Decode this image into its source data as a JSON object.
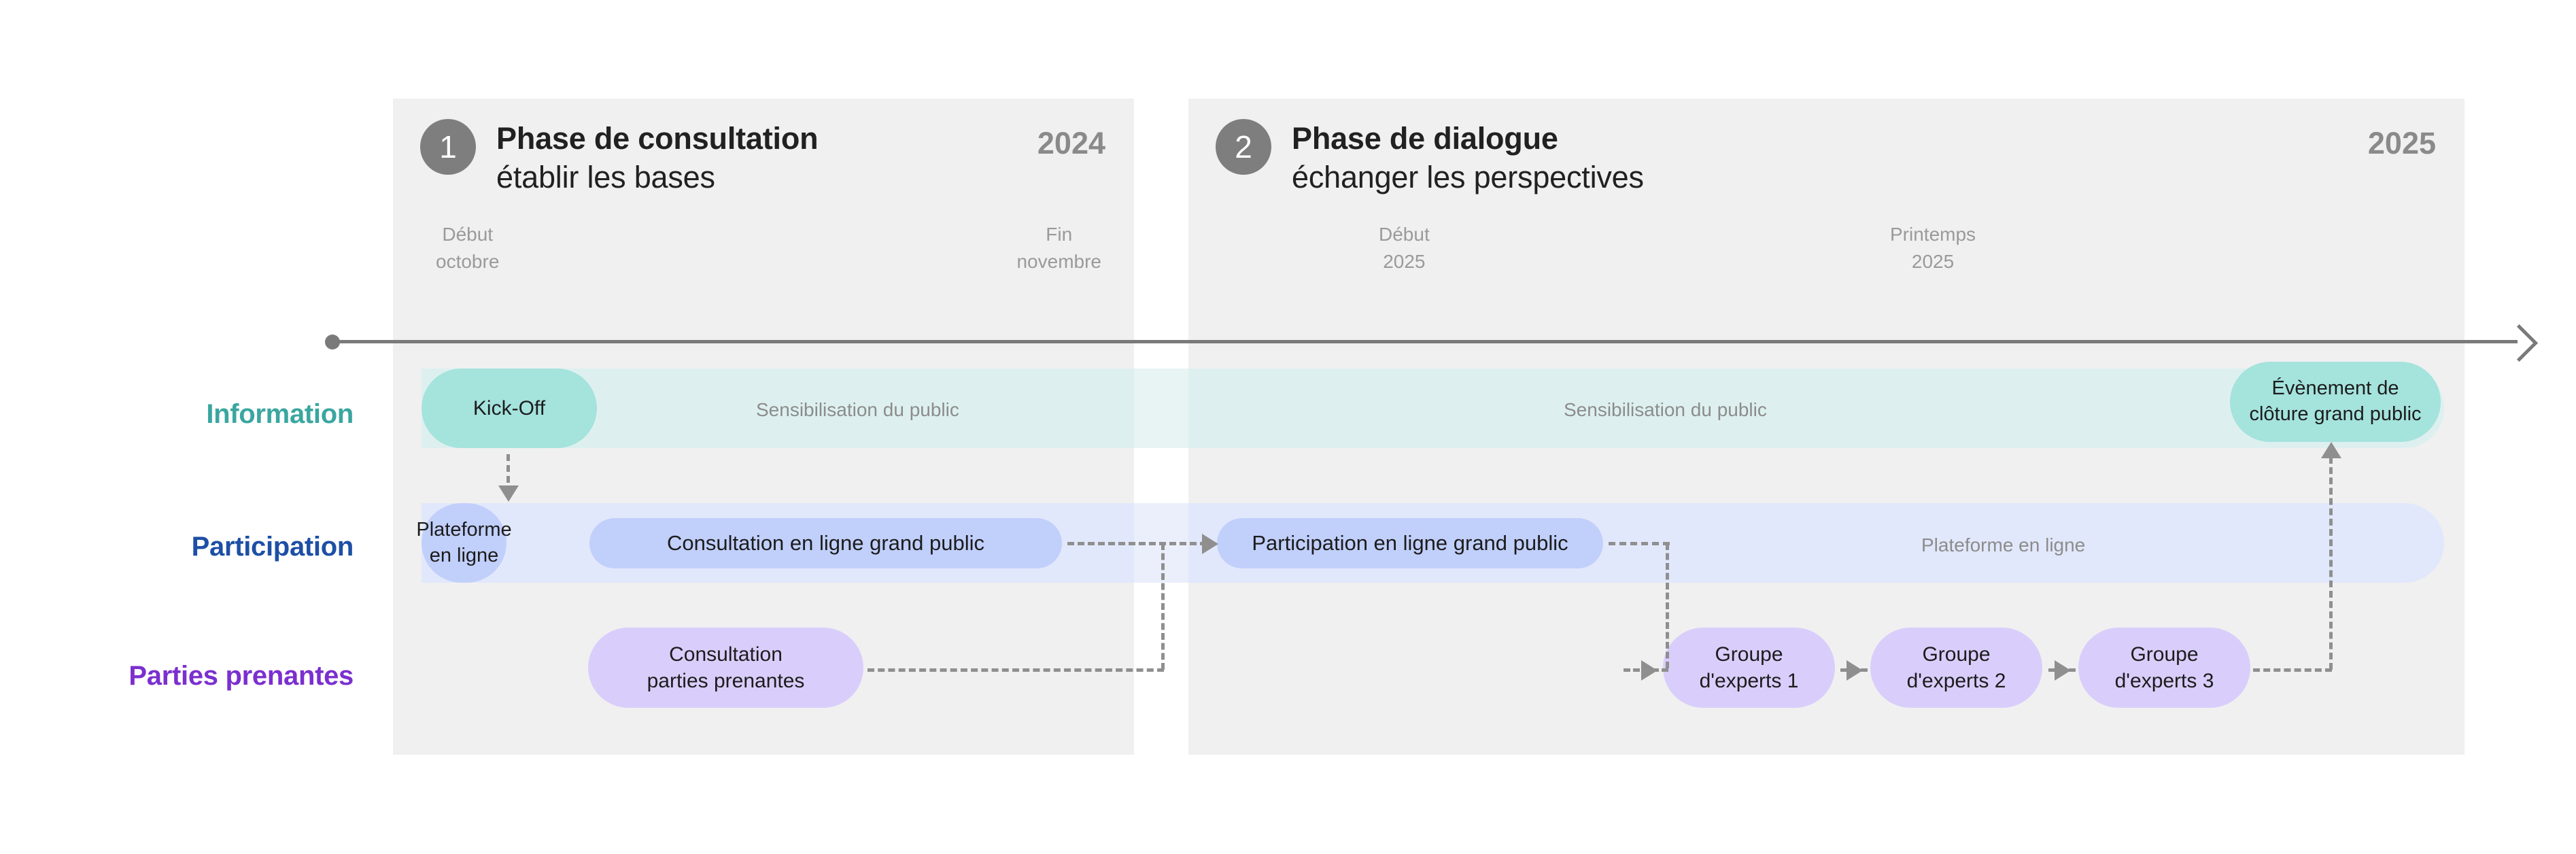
{
  "phases": [
    {
      "number": "1",
      "title": "Phase de consultation",
      "subtitle": "établir les bases",
      "year": "2024",
      "start_label": "Début\noctobre",
      "start_line1": "Début",
      "start_line2": "octobre",
      "end_line1": "Fin",
      "end_line2": "novembre"
    },
    {
      "number": "2",
      "title": "Phase de dialogue",
      "subtitle": "échanger les perspectives",
      "year": "2025",
      "start_line1": "Début",
      "start_line2": "2025",
      "end_line1": "Printemps",
      "end_line2": "2025"
    }
  ],
  "rows": [
    {
      "label": "Information",
      "color": "#3aa6a0"
    },
    {
      "label": "Participation",
      "color": "#1d4fa5"
    },
    {
      "label": "Parties prenantes",
      "color": "#7b2fcf"
    }
  ],
  "bands": {
    "information_caption_phase1": "Sensibilisation du public",
    "information_caption_phase2": "Sensibilisation du public",
    "participation_caption_phase2": "Plateforme en ligne"
  },
  "items": {
    "kickoff": "Kick-Off",
    "event_cloture_line1": "Évènement de",
    "event_cloture_line2": "clôture grand public",
    "plateforme_line1": "Plateforme",
    "plateforme_line2": "en ligne",
    "consultation_online": "Consultation en ligne grand public",
    "participation_online": "Participation en ligne grand public",
    "consultation_parties_line1": "Consultation",
    "consultation_parties_line2": "parties prenantes",
    "expert1_line1": "Groupe",
    "expert1_line2": "d'experts 1",
    "expert2_line1": "Groupe",
    "expert2_line2": "d'experts 2",
    "expert3_line1": "Groupe",
    "expert3_line2": "d'experts 3"
  },
  "colors": {
    "panel_bg": "#f0f0f0",
    "axis": "#7a7a7a",
    "badge": "#7e7e7e",
    "band_information": "#ddf0ef",
    "band_participation": "#e2e8fb",
    "pill_information": "#a5e3dd",
    "pill_participation": "#c1cffb",
    "pill_parties": "#d9cefb",
    "connector": "#8f8f8f",
    "muted_text": "#9a9a9a"
  }
}
